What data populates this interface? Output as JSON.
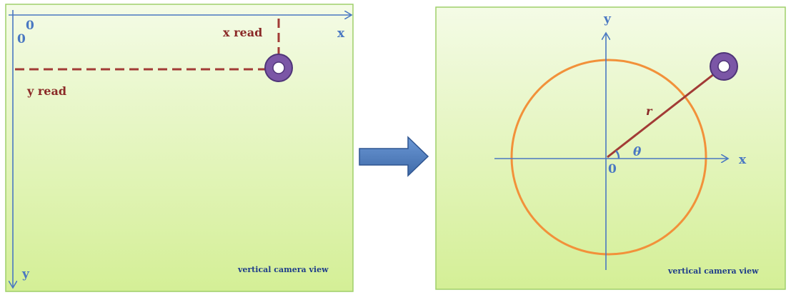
{
  "left_panel": {
    "origin_label_inner": "0",
    "origin_label_outer": "0",
    "x_axis_label": "x",
    "y_axis_label": "y",
    "x_read_label": "x read",
    "y_read_label": "y read",
    "caption": "vertical camera view"
  },
  "right_panel": {
    "x_axis_label": "x",
    "y_axis_label": "y",
    "origin_label": "0",
    "radius_label": "r",
    "angle_label": "θ",
    "caption": "vertical camera view"
  },
  "colors": {
    "panel_top": "#f4fbe6",
    "panel_bottom": "#d6f09a",
    "panel_border": "#9fcf6a",
    "axis_blue": "#4a78c2",
    "read_red": "#a23b36",
    "circle_orange": "#f2913a",
    "marker_purple": "#7b56a6",
    "arrow_fill": "#4f7fc2"
  },
  "icons": [
    "transform-arrow-icon",
    "target-marker-icon"
  ]
}
